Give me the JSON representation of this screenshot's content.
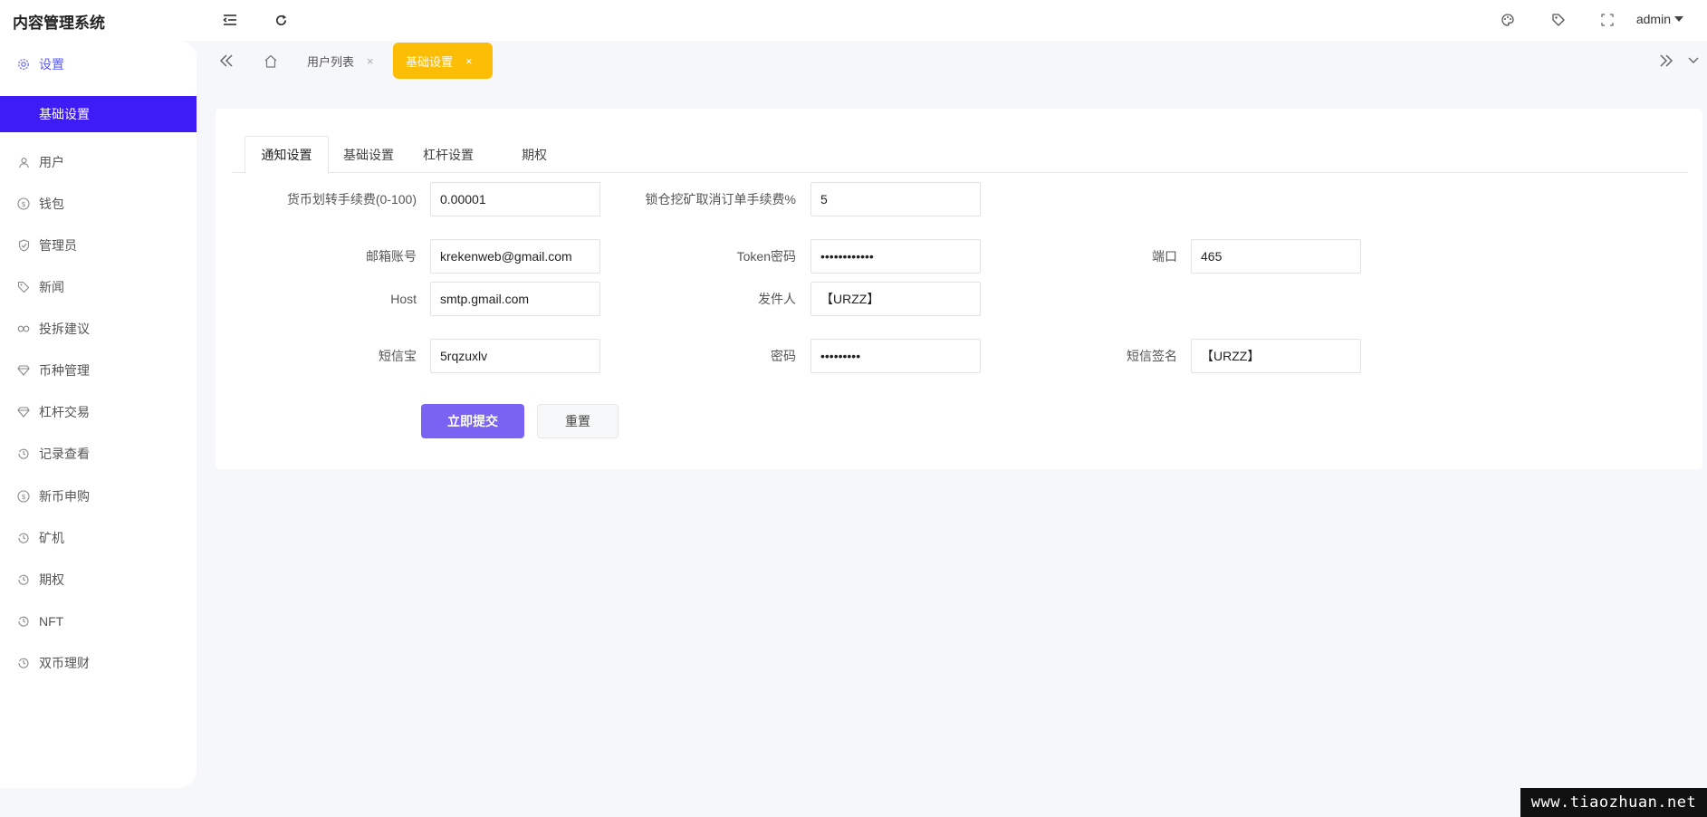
{
  "app": {
    "title": "内容管理系统"
  },
  "header": {
    "icons": [
      "menu-fold-icon",
      "refresh-icon",
      "theme-palette-icon",
      "tag-icon",
      "fullscreen-icon"
    ],
    "user": "admin"
  },
  "sidebar": {
    "items": [
      {
        "label": "设置",
        "icon": "gear-icon",
        "active": true
      },
      {
        "label": "用户",
        "icon": "user-icon"
      },
      {
        "label": "钱包",
        "icon": "dollar-circle-icon"
      },
      {
        "label": "管理员",
        "icon": "shield-icon"
      },
      {
        "label": "新闻",
        "icon": "tag-icon"
      },
      {
        "label": "投拆建议",
        "icon": "link-icon"
      },
      {
        "label": "币种管理",
        "icon": "diamond-icon"
      },
      {
        "label": "杠杆交易",
        "icon": "diamond-icon"
      },
      {
        "label": "记录查看",
        "icon": "history-icon"
      },
      {
        "label": "新币申购",
        "icon": "dollar-circle-icon"
      },
      {
        "label": "矿机",
        "icon": "history-icon"
      },
      {
        "label": "期权",
        "icon": "history-icon"
      },
      {
        "label": "NFT",
        "icon": "history-icon"
      },
      {
        "label": "双币理财",
        "icon": "history-icon"
      }
    ],
    "sub_active": "基础设置"
  },
  "page_tabs": {
    "items": [
      {
        "label": "用户列表",
        "close": "×"
      },
      {
        "label": "基础设置",
        "close": "×",
        "active": true
      }
    ],
    "accent_color": "#fbbd05"
  },
  "form": {
    "tabs": [
      "通知设置",
      "基础设置",
      "杠杆设置",
      "期权"
    ],
    "active_tab": "通知设置",
    "fields": {
      "transfer_fee": {
        "label": "货币划转手续费(0-100)",
        "value": "0.00001"
      },
      "lock_cancel_fee": {
        "label": "锁仓挖矿取消订单手续费%",
        "value": "5"
      },
      "email_account": {
        "label": "邮箱账号",
        "value": "krekenweb@gmail.com"
      },
      "token_password": {
        "label": "Token密码",
        "value": "••••••••••••"
      },
      "port": {
        "label": "端口",
        "value": "465"
      },
      "host": {
        "label": "Host",
        "value": "smtp.gmail.com"
      },
      "sender": {
        "label": "发件人",
        "value": "【URZZ】"
      },
      "sms_account": {
        "label": "短信宝",
        "value": "5rqzuxlv"
      },
      "sms_password": {
        "label": "密码",
        "value": "•••••••••"
      },
      "sms_signature": {
        "label": "短信签名",
        "value": "【URZZ】"
      }
    },
    "submit_label": "立即提交",
    "reset_label": "重置",
    "primary_color": "#7a63f2"
  },
  "watermark": "www.tiaozhuan.net"
}
